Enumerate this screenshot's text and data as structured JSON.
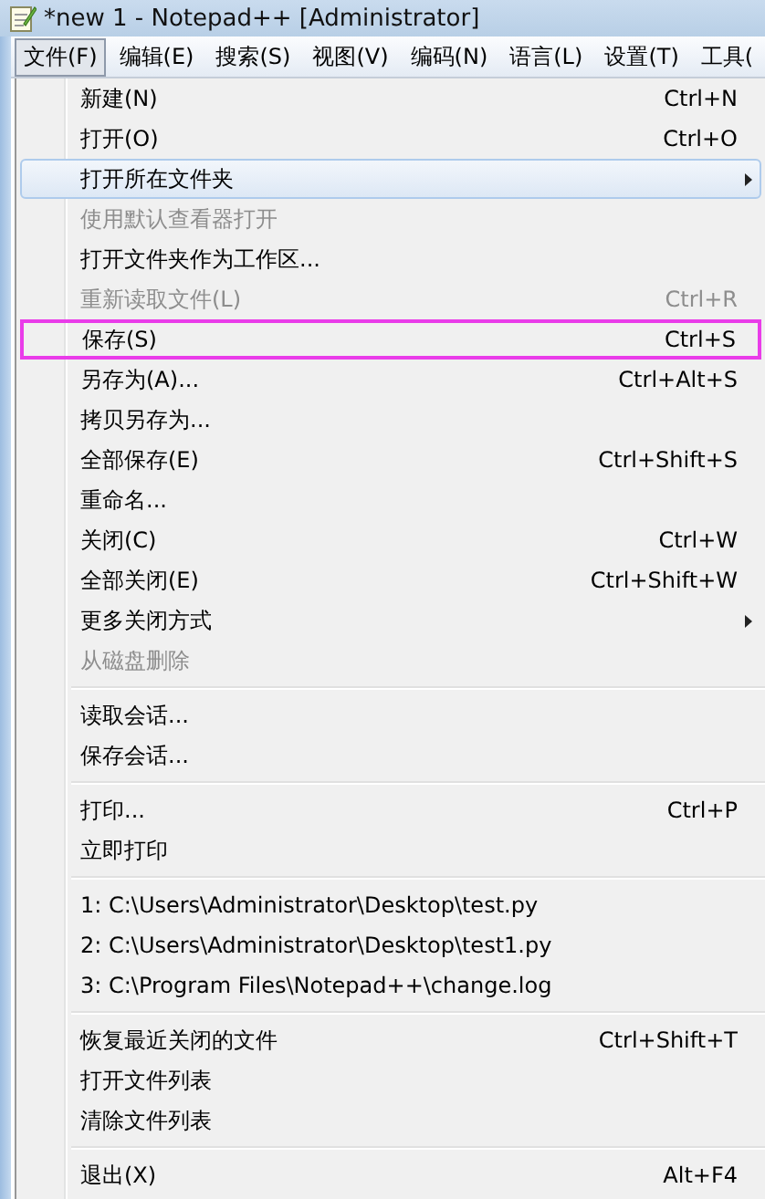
{
  "window": {
    "title": "*new 1 - Notepad++ [Administrator]"
  },
  "menubar": [
    {
      "label": "文件(F)",
      "selected": true
    },
    {
      "label": "编辑(E)",
      "selected": false
    },
    {
      "label": "搜索(S)",
      "selected": false
    },
    {
      "label": "视图(V)",
      "selected": false
    },
    {
      "label": "编码(N)",
      "selected": false
    },
    {
      "label": "语言(L)",
      "selected": false
    },
    {
      "label": "设置(T)",
      "selected": false
    },
    {
      "label": "工具(",
      "selected": false
    }
  ],
  "menu": [
    {
      "kind": "item",
      "label": "新建(N)",
      "shortcut": "Ctrl+N",
      "disabled": false,
      "selected": false,
      "submenu": false,
      "marked": false
    },
    {
      "kind": "item",
      "label": "打开(O)",
      "shortcut": "Ctrl+O",
      "disabled": false,
      "selected": false,
      "submenu": false,
      "marked": false
    },
    {
      "kind": "item",
      "label": "打开所在文件夹",
      "disabled": false,
      "selected": true,
      "submenu": true,
      "marked": false
    },
    {
      "kind": "item",
      "label": "使用默认查看器打开",
      "disabled": true,
      "selected": false,
      "submenu": false,
      "marked": false
    },
    {
      "kind": "item",
      "label": "打开文件夹作为工作区...",
      "disabled": false,
      "selected": false,
      "submenu": false,
      "marked": false
    },
    {
      "kind": "item",
      "label": "重新读取文件(L)",
      "shortcut": "Ctrl+R",
      "disabled": true,
      "selected": false,
      "submenu": false,
      "marked": false
    },
    {
      "kind": "item",
      "label": "保存(S)",
      "shortcut": "Ctrl+S",
      "disabled": false,
      "selected": false,
      "submenu": false,
      "marked": true
    },
    {
      "kind": "item",
      "label": "另存为(A)...",
      "shortcut": "Ctrl+Alt+S",
      "disabled": false,
      "selected": false,
      "submenu": false,
      "marked": false
    },
    {
      "kind": "item",
      "label": "拷贝另存为...",
      "disabled": false,
      "selected": false,
      "submenu": false,
      "marked": false
    },
    {
      "kind": "item",
      "label": "全部保存(E)",
      "shortcut": "Ctrl+Shift+S",
      "disabled": false,
      "selected": false,
      "submenu": false,
      "marked": false
    },
    {
      "kind": "item",
      "label": "重命名...",
      "disabled": false,
      "selected": false,
      "submenu": false,
      "marked": false
    },
    {
      "kind": "item",
      "label": "关闭(C)",
      "shortcut": "Ctrl+W",
      "disabled": false,
      "selected": false,
      "submenu": false,
      "marked": false
    },
    {
      "kind": "item",
      "label": "全部关闭(E)",
      "shortcut": "Ctrl+Shift+W",
      "disabled": false,
      "selected": false,
      "submenu": false,
      "marked": false
    },
    {
      "kind": "item",
      "label": "更多关闭方式",
      "disabled": false,
      "selected": false,
      "submenu": true,
      "marked": false
    },
    {
      "kind": "item",
      "label": "从磁盘删除",
      "disabled": true,
      "selected": false,
      "submenu": false,
      "marked": false
    },
    {
      "kind": "separator"
    },
    {
      "kind": "item",
      "label": "读取会话...",
      "disabled": false,
      "selected": false,
      "submenu": false,
      "marked": false
    },
    {
      "kind": "item",
      "label": "保存会话...",
      "disabled": false,
      "selected": false,
      "submenu": false,
      "marked": false
    },
    {
      "kind": "separator"
    },
    {
      "kind": "item",
      "label": "打印...",
      "shortcut": "Ctrl+P",
      "disabled": false,
      "selected": false,
      "submenu": false,
      "marked": false
    },
    {
      "kind": "item",
      "label": "立即打印",
      "disabled": false,
      "selected": false,
      "submenu": false,
      "marked": false
    },
    {
      "kind": "separator"
    },
    {
      "kind": "item",
      "label": "1: C:\\Users\\Administrator\\Desktop\\test.py",
      "disabled": false,
      "selected": false,
      "submenu": false,
      "marked": false
    },
    {
      "kind": "item",
      "label": "2: C:\\Users\\Administrator\\Desktop\\test1.py",
      "disabled": false,
      "selected": false,
      "submenu": false,
      "marked": false
    },
    {
      "kind": "item",
      "label": "3: C:\\Program Files\\Notepad++\\change.log",
      "disabled": false,
      "selected": false,
      "submenu": false,
      "marked": false
    },
    {
      "kind": "separator"
    },
    {
      "kind": "item",
      "label": "恢复最近关闭的文件",
      "shortcut": "Ctrl+Shift+T",
      "disabled": false,
      "selected": false,
      "submenu": false,
      "marked": false
    },
    {
      "kind": "item",
      "label": "打开文件列表",
      "disabled": false,
      "selected": false,
      "submenu": false,
      "marked": false
    },
    {
      "kind": "item",
      "label": "清除文件列表",
      "disabled": false,
      "selected": false,
      "submenu": false,
      "marked": false
    },
    {
      "kind": "separator"
    },
    {
      "kind": "item",
      "label": "退出(X)",
      "shortcut": "Alt+F4",
      "disabled": false,
      "selected": false,
      "submenu": false,
      "marked": false
    }
  ]
}
